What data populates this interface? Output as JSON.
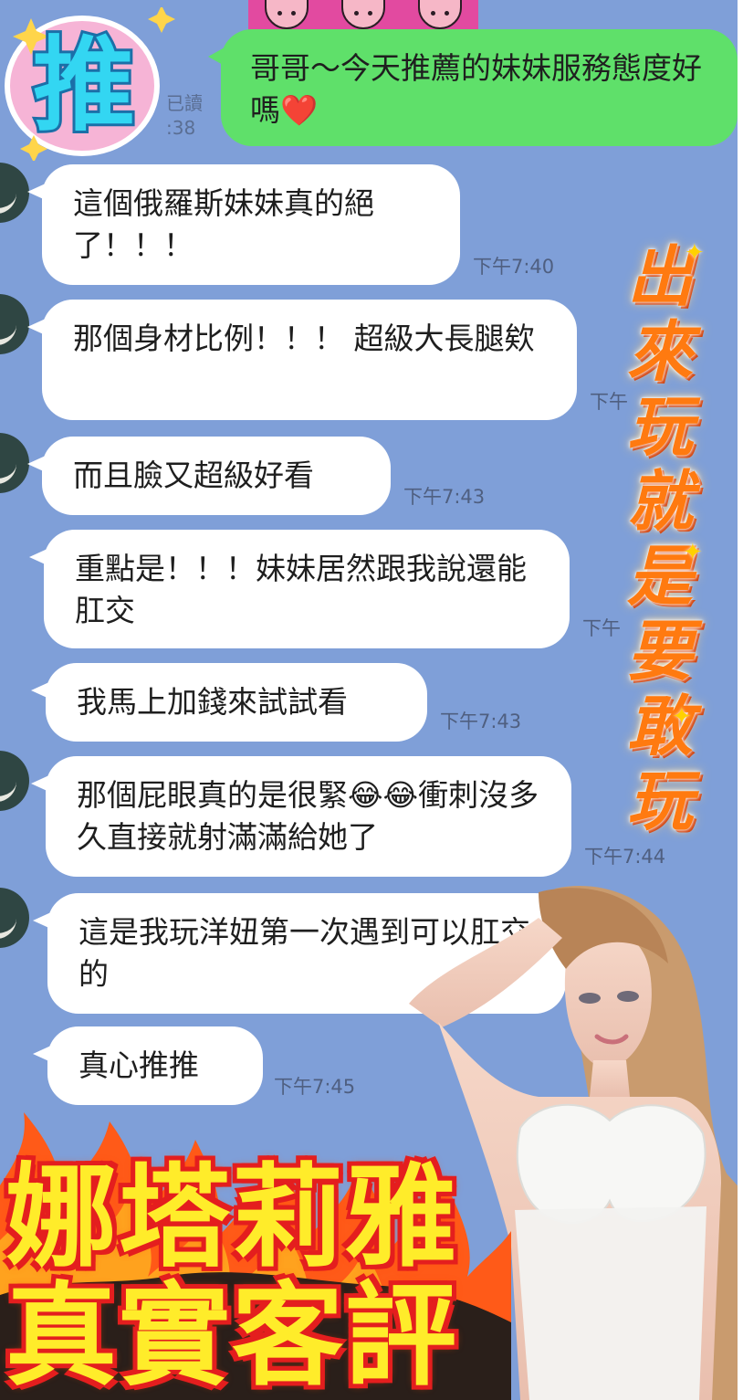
{
  "header": {
    "read_status": "已讀",
    "sent_time": ":38"
  },
  "outgoing": {
    "text": "哥哥～今天推薦的妹妹服務態度好嗎",
    "emoji": "❤️"
  },
  "badge": {
    "text": "推"
  },
  "messages": [
    {
      "text": "這個俄羅斯妹妹真的絕了！！！",
      "time": "下午7:40"
    },
    {
      "text": "那個身材比例！！！ 超級大長腿欸",
      "time": "下午"
    },
    {
      "text": "而且臉又超級好看",
      "time": "下午7:43"
    },
    {
      "text": "重點是！！！妹妹居然跟我說還能肛交",
      "time": "下午"
    },
    {
      "text": "我馬上加錢來試試看",
      "time": "下午7:43"
    },
    {
      "text": "那個屁眼真的是很緊😂😂衝刺沒多久直接就射滿滿給她了",
      "time": "下午7:44"
    },
    {
      "text": "這是我玩洋妞第一次遇到可以肛交的",
      "time": ""
    },
    {
      "text": "真心推推",
      "time": "下午7:45"
    }
  ],
  "slogan": [
    "出",
    "來",
    "玩",
    "就",
    "是",
    "要",
    "敢",
    "玩"
  ],
  "banner": {
    "line1": "娜塔莉雅",
    "line2": "真實客評"
  },
  "icons": {
    "avatar": "avatar-icon",
    "heart": "heart-emoji-icon",
    "laugh": "tears-of-joy-emoji-icon"
  },
  "colors": {
    "background": "#7f9fd8",
    "outgoing_bubble": "#5fe06a",
    "incoming_bubble": "#ffffff",
    "banner_text": "#ffec2a",
    "banner_outline": "#e41e1e",
    "slogan_text": "#ff7a10"
  }
}
